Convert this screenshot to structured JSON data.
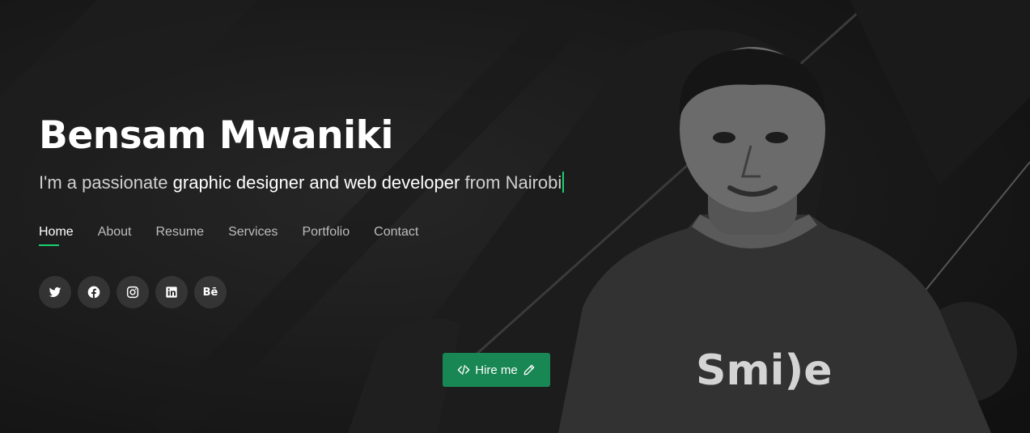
{
  "hero": {
    "name": "Bensam Mwaniki",
    "tagline_prefix": "I'm a passionate",
    "tagline_typed": "graphic designer and web developer",
    "tagline_suffix": "from Nairobi"
  },
  "nav": {
    "items": [
      {
        "label": "Home",
        "active": true
      },
      {
        "label": "About"
      },
      {
        "label": "Resume"
      },
      {
        "label": "Services"
      },
      {
        "label": "Portfolio"
      },
      {
        "label": "Contact"
      }
    ]
  },
  "social": {
    "icons": [
      "twitter-icon",
      "facebook-icon",
      "instagram-icon",
      "linkedin-icon",
      "behance-icon"
    ],
    "behance_text": "Bē"
  },
  "cta": {
    "label": "Hire me"
  },
  "photo": {
    "shirt_text": "Smi)e"
  },
  "colors": {
    "accent": "#18d26e",
    "button": "#198754",
    "background": "#141414"
  }
}
